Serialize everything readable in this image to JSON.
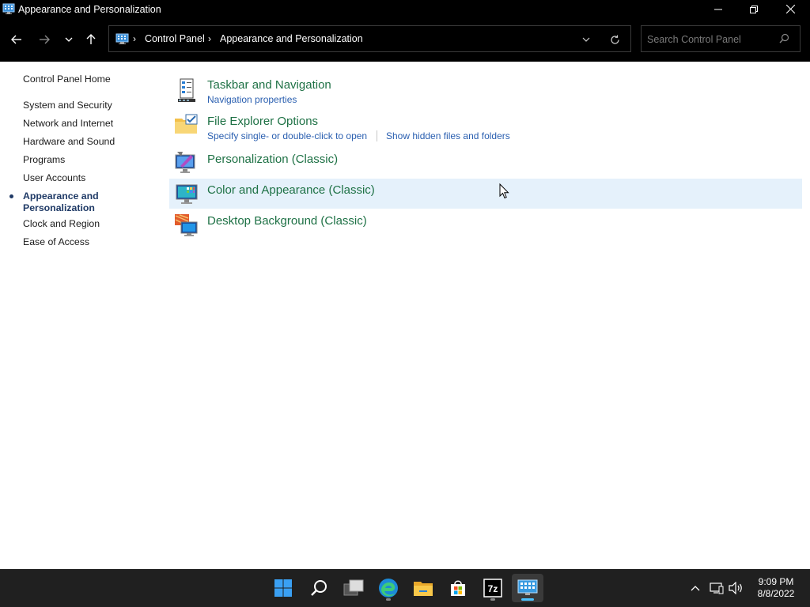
{
  "window": {
    "title": "Appearance and Personalization"
  },
  "nav": {
    "breadcrumb": [
      "Control Panel",
      "Appearance and Personalization"
    ],
    "search_placeholder": "Search Control Panel"
  },
  "sidebar": {
    "home": "Control Panel Home",
    "items": [
      {
        "label": "System and Security"
      },
      {
        "label": "Network and Internet"
      },
      {
        "label": "Hardware and Sound"
      },
      {
        "label": "Programs"
      },
      {
        "label": "User Accounts"
      },
      {
        "label": "Appearance and Personalization",
        "active": true
      },
      {
        "label": "Clock and Region"
      },
      {
        "label": "Ease of Access"
      }
    ]
  },
  "categories": [
    {
      "title": "Taskbar and Navigation",
      "icon": "taskbar-icon",
      "links": [
        "Navigation properties"
      ]
    },
    {
      "title": "File Explorer Options",
      "icon": "folder-options-icon",
      "links": [
        "Specify single- or double-click to open",
        "Show hidden files and folders"
      ]
    },
    {
      "title": "Personalization (Classic)",
      "icon": "personalization-icon",
      "links": []
    },
    {
      "title": "Color and Appearance (Classic)",
      "icon": "color-appearance-icon",
      "links": [],
      "hovered": true
    },
    {
      "title": "Desktop Background (Classic)",
      "icon": "desktop-background-icon",
      "links": []
    }
  ],
  "taskbar": {
    "apps": [
      "start-icon",
      "search-icon",
      "task-view-icon",
      "edge-icon",
      "file-explorer-icon",
      "store-icon",
      "7zip-icon",
      "control-panel-icon"
    ],
    "time": "9:09 PM",
    "date": "8/8/2022"
  },
  "colors": {
    "category_title": "#1e7145",
    "link": "#2a5fb0",
    "hover_bg": "#e5f1fb",
    "titlebar_bg": "#000000",
    "taskbar_bg": "#202020"
  }
}
